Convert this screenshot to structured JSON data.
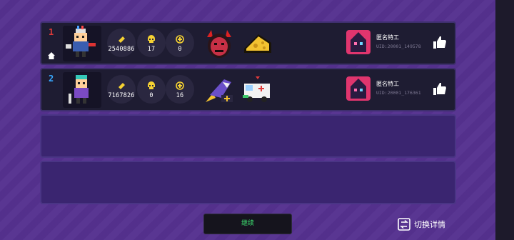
{
  "rows": [
    {
      "rank": "1",
      "stats": [
        "2540886",
        "17",
        "0"
      ],
      "items": [
        "demon-mask-icon",
        "cheese-icon"
      ],
      "player": {
        "name": "匿名特工",
        "uid": "UID:20001_149578"
      }
    },
    {
      "rank": "2",
      "stats": [
        "7167826",
        "0",
        "16"
      ],
      "items": [
        "shark-rocket-icon",
        "ambulance-icon"
      ],
      "player": {
        "name": "匿名特工",
        "uid": "UID:20001_176361"
      }
    }
  ],
  "colors": {
    "rank1": "#e03a3a",
    "rank2": "#38a8ff",
    "continue_text": "#3ee071",
    "background": "#55318f",
    "avatar": "#e0356e"
  },
  "footer": {
    "continue_label": "继续",
    "switch_label": "切换详情"
  }
}
